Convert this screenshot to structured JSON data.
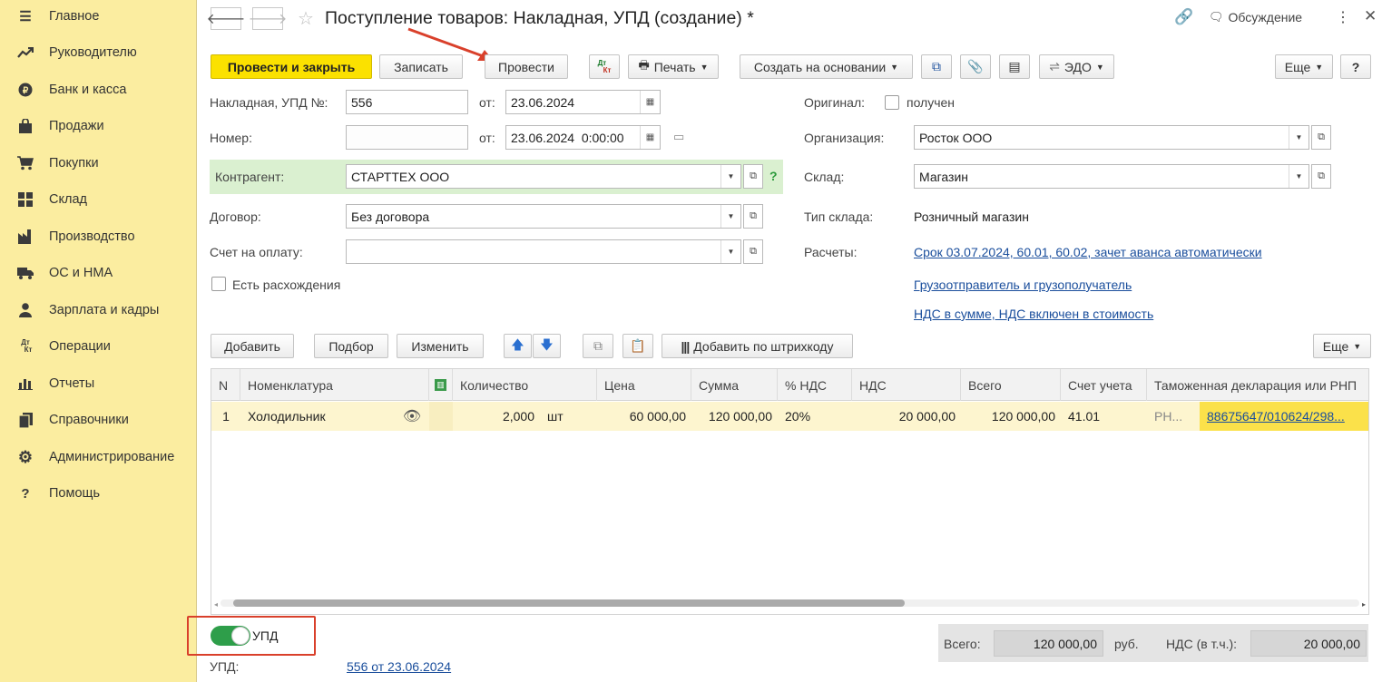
{
  "sidebar": {
    "items": [
      {
        "icon": "menu-icon",
        "label": "Главное"
      },
      {
        "icon": "trend-icon",
        "label": "Руководителю"
      },
      {
        "icon": "bank-icon",
        "label": "Банк и касса"
      },
      {
        "icon": "bag-icon",
        "label": "Продажи"
      },
      {
        "icon": "cart-icon",
        "label": "Покупки"
      },
      {
        "icon": "warehouse-icon",
        "label": "Склад"
      },
      {
        "icon": "factory-icon",
        "label": "Производство"
      },
      {
        "icon": "truck-icon",
        "label": "ОС и НМА"
      },
      {
        "icon": "person-icon",
        "label": "Зарплата и кадры"
      },
      {
        "icon": "dt-kt-icon",
        "label": "Операции"
      },
      {
        "icon": "bar-chart-icon",
        "label": "Отчеты"
      },
      {
        "icon": "books-icon",
        "label": "Справочники"
      },
      {
        "icon": "gear-icon",
        "label": "Администрирование"
      },
      {
        "icon": "question-icon",
        "label": "Помощь"
      }
    ]
  },
  "header": {
    "title": "Поступление товаров: Накладная, УПД (создание) *",
    "discussion": "Обсуждение"
  },
  "toolbar": {
    "post_close": "Провести и закрыть",
    "save": "Записать",
    "post": "Провести",
    "print": "Печать",
    "create_based": "Создать на основании",
    "edo": "ЭДО",
    "more": "Еще",
    "help": "?"
  },
  "form": {
    "invoice_label": "Накладная, УПД №:",
    "invoice_no": "556",
    "from_label": "от:",
    "invoice_date": "23.06.2024",
    "number_label": "Номер:",
    "number_value": "",
    "number_from_label": "от:",
    "number_date": "23.06.2024  0:00:00",
    "counterparty_label": "Контрагент:",
    "counterparty": "СТАРТТЕХ ООО",
    "contract_label": "Договор:",
    "contract": "Без договора",
    "payment_label": "Счет на оплату:",
    "payment": "",
    "discrepancy_label": "Есть расхождения",
    "original_label": "Оригинал:",
    "original_checkbox": "получен",
    "org_label": "Организация:",
    "org": "Росток ООО",
    "stock_label": "Склад:",
    "stock": "Магазин",
    "stock_type_label": "Тип склада:",
    "stock_type": "Розничный магазин",
    "settlements_label": "Расчеты:",
    "settlements_link": "Срок 03.07.2024, 60.01, 60.02, зачет аванса автоматически",
    "shipper_link": "Грузоотправитель и грузополучатель",
    "vat_link": "НДС в сумме, НДС включен в стоимость",
    "help_mark": "?"
  },
  "table_toolbar": {
    "add": "Добавить",
    "pick": "Подбор",
    "edit": "Изменить",
    "barcode": "Добавить по штрихкоду",
    "more": "Еще"
  },
  "table": {
    "columns": [
      "N",
      "Номенклатура",
      "Количество",
      "Цена",
      "Сумма",
      "% НДС",
      "НДС",
      "Всего",
      "Счет учета",
      "Таможенная декларация или РНП"
    ],
    "rows": [
      {
        "n": "1",
        "name": "Холодильник",
        "qty": "2,000",
        "unit": "шт",
        "price": "60 000,00",
        "sum": "120 000,00",
        "vat_rate": "20%",
        "vat": "20 000,00",
        "total": "120 000,00",
        "account": "41.01",
        "rnp": "РН...",
        "declaration": "88675647/010624/298..."
      }
    ]
  },
  "footer": {
    "upd_toggle_label": "УПД",
    "upd_label": "УПД:",
    "upd_link": "556 от 23.06.2024",
    "total_label": "Всего:",
    "total_value": "120 000,00",
    "currency": "руб.",
    "vat_label": "НДС (в т.ч.):",
    "vat_value": "20 000,00"
  }
}
